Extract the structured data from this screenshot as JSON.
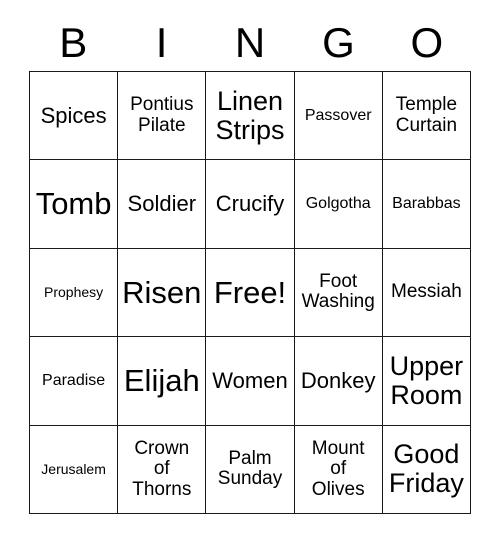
{
  "card": {
    "type": "bingo-card",
    "columns": 5,
    "rows": 5,
    "header": {
      "letters": [
        "B",
        "I",
        "N",
        "G",
        "O"
      ]
    },
    "colors": {
      "background": "#ffffff",
      "text": "#000000",
      "border": "#1a1a1a"
    },
    "cells": [
      {
        "text": "Spices",
        "size": "lg",
        "free": false
      },
      {
        "text": "Pontius\nPilate",
        "size": "md",
        "free": false
      },
      {
        "text": "Linen\nStrips",
        "size": "xl",
        "free": false
      },
      {
        "text": "Passover",
        "size": "sm",
        "free": false
      },
      {
        "text": "Temple\nCurtain",
        "size": "md",
        "free": false
      },
      {
        "text": "Tomb",
        "size": "xxl",
        "free": false
      },
      {
        "text": "Soldier",
        "size": "lg",
        "free": false
      },
      {
        "text": "Crucify",
        "size": "lg",
        "free": false
      },
      {
        "text": "Golgotha",
        "size": "sm",
        "free": false
      },
      {
        "text": "Barabbas",
        "size": "sm",
        "free": false
      },
      {
        "text": "Prophesy",
        "size": "xs",
        "free": false
      },
      {
        "text": "Risen",
        "size": "xxl",
        "free": false
      },
      {
        "text": "Free!",
        "size": "xxl",
        "free": true
      },
      {
        "text": "Foot\nWashing",
        "size": "md",
        "free": false
      },
      {
        "text": "Messiah",
        "size": "md",
        "free": false
      },
      {
        "text": "Paradise",
        "size": "sm",
        "free": false
      },
      {
        "text": "Elijah",
        "size": "xxl",
        "free": false
      },
      {
        "text": "Women",
        "size": "lg",
        "free": false
      },
      {
        "text": "Donkey",
        "size": "lg",
        "free": false
      },
      {
        "text": "Upper\nRoom",
        "size": "xl",
        "free": false
      },
      {
        "text": "Jerusalem",
        "size": "xs",
        "free": false
      },
      {
        "text": "Crown\nof\nThorns",
        "size": "md",
        "free": false
      },
      {
        "text": "Palm\nSunday",
        "size": "md",
        "free": false
      },
      {
        "text": "Mount\nof\nOlives",
        "size": "md",
        "free": false
      },
      {
        "text": "Good\nFriday",
        "size": "xl",
        "free": false
      }
    ]
  }
}
